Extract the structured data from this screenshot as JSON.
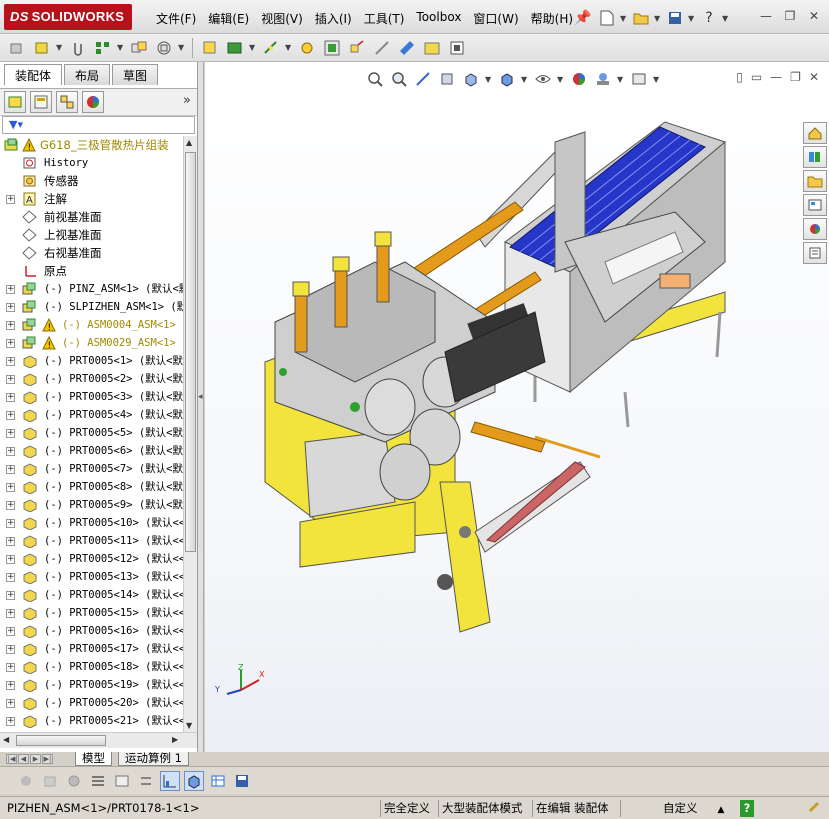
{
  "app": {
    "logo_brand": "SOLIDWORKS",
    "logo_prefix": "DS"
  },
  "menu": [
    "文件(F)",
    "编辑(E)",
    "视图(V)",
    "插入(I)",
    "工具(T)",
    "Toolbox",
    "窗口(W)",
    "帮助(H)"
  ],
  "panel": {
    "tabs": [
      "装配体",
      "布局",
      "草图"
    ],
    "active_tab": "装配体"
  },
  "tree": {
    "root": "G618_三极管散热片组装",
    "items": [
      {
        "label": "History",
        "mono": true,
        "icon": "history-icon",
        "expander": false
      },
      {
        "label": "传感器",
        "icon": "sensor-icon",
        "expander": false
      },
      {
        "label": "注解",
        "icon": "annotation-icon",
        "expander": true
      },
      {
        "label": "前视基准面",
        "icon": "plane-icon",
        "expander": false
      },
      {
        "label": "上视基准面",
        "icon": "plane-icon",
        "expander": false
      },
      {
        "label": "右视基准面",
        "icon": "plane-icon",
        "expander": false
      },
      {
        "label": "原点",
        "icon": "origin-icon",
        "expander": false
      },
      {
        "label": "(-) PINZ_ASM<1> (默认<默",
        "icon": "assembly-icon",
        "expander": true,
        "mono": true
      },
      {
        "label": "(-) SLPIZHEN_ASM<1> (默",
        "icon": "assembly-icon",
        "expander": true,
        "mono": true
      },
      {
        "label": "(-) ASM0004_ASM<1> (",
        "icon": "assembly-icon",
        "expander": true,
        "warning": true,
        "mono": true
      },
      {
        "label": "(-) ASM0029_ASM<1> (",
        "icon": "assembly-icon",
        "expander": true,
        "warning": true,
        "mono": true
      },
      {
        "label": "(-) PRT0005<1> (默认<默",
        "icon": "part-icon",
        "expander": true,
        "mono": true
      },
      {
        "label": "(-) PRT0005<2> (默认<默",
        "icon": "part-icon",
        "expander": true,
        "mono": true
      },
      {
        "label": "(-) PRT0005<3> (默认<默",
        "icon": "part-icon",
        "expander": true,
        "mono": true
      },
      {
        "label": "(-) PRT0005<4> (默认<默",
        "icon": "part-icon",
        "expander": true,
        "mono": true
      },
      {
        "label": "(-) PRT0005<5> (默认<默",
        "icon": "part-icon",
        "expander": true,
        "mono": true
      },
      {
        "label": "(-) PRT0005<6> (默认<默",
        "icon": "part-icon",
        "expander": true,
        "mono": true
      },
      {
        "label": "(-) PRT0005<7> (默认<默",
        "icon": "part-icon",
        "expander": true,
        "mono": true
      },
      {
        "label": "(-) PRT0005<8> (默认<默",
        "icon": "part-icon",
        "expander": true,
        "mono": true
      },
      {
        "label": "(-) PRT0005<9> (默认<默",
        "icon": "part-icon",
        "expander": true,
        "mono": true
      },
      {
        "label": "(-) PRT0005<10> (默认<<",
        "icon": "part-icon",
        "expander": true,
        "mono": true
      },
      {
        "label": "(-) PRT0005<11> (默认<<",
        "icon": "part-icon",
        "expander": true,
        "mono": true
      },
      {
        "label": "(-) PRT0005<12> (默认<<",
        "icon": "part-icon",
        "expander": true,
        "mono": true
      },
      {
        "label": "(-) PRT0005<13> (默认<<",
        "icon": "part-icon",
        "expander": true,
        "mono": true
      },
      {
        "label": "(-) PRT0005<14> (默认<<",
        "icon": "part-icon",
        "expander": true,
        "mono": true
      },
      {
        "label": "(-) PRT0005<15> (默认<<",
        "icon": "part-icon",
        "expander": true,
        "mono": true
      },
      {
        "label": "(-) PRT0005<16> (默认<<",
        "icon": "part-icon",
        "expander": true,
        "mono": true
      },
      {
        "label": "(-) PRT0005<17> (默认<<",
        "icon": "part-icon",
        "expander": true,
        "mono": true
      },
      {
        "label": "(-) PRT0005<18> (默认<<",
        "icon": "part-icon",
        "expander": true,
        "mono": true
      },
      {
        "label": "(-) PRT0005<19> (默认<<",
        "icon": "part-icon",
        "expander": true,
        "mono": true
      },
      {
        "label": "(-) PRT0005<20> (默认<<",
        "icon": "part-icon",
        "expander": true,
        "mono": true
      },
      {
        "label": "(-) PRT0005<21> (默认<<",
        "icon": "part-icon",
        "expander": true,
        "mono": true
      }
    ]
  },
  "bottom_tabs": [
    "模型",
    "运动算例 1"
  ],
  "status": {
    "path": "PIZHEN_ASM<1>/PRT0178-1<1>",
    "fully_defined": "完全定义",
    "large_mode": "大型装配体模式",
    "editing": "在编辑 装配体",
    "custom": "自定义"
  },
  "colors": {
    "accent_red": "#b5121b",
    "part_yellow": "#f2e43c",
    "heatsink_blue": "#2536c9"
  }
}
